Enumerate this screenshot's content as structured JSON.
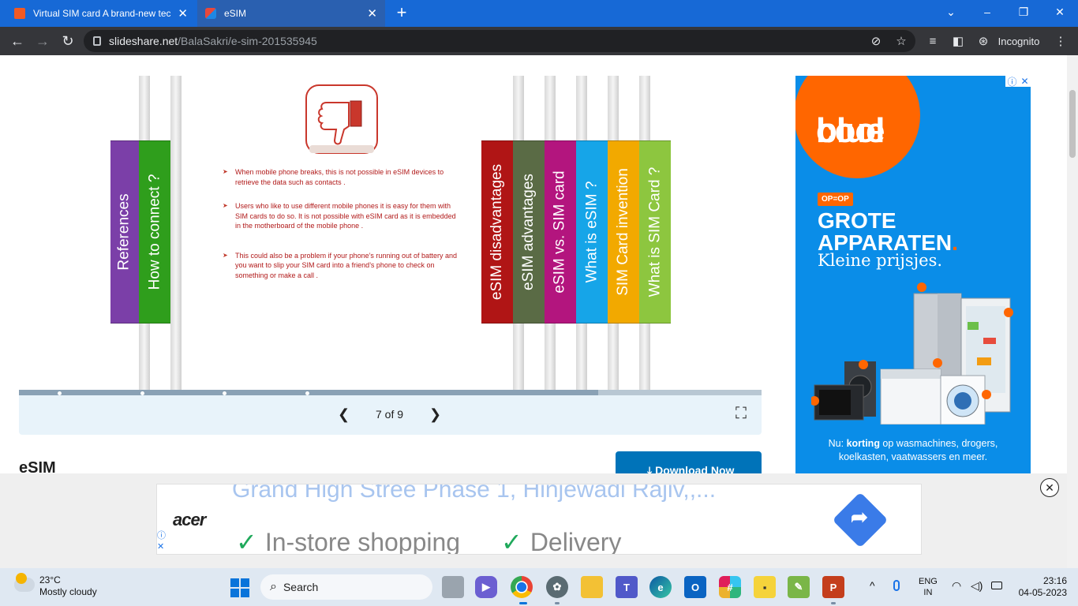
{
  "browser": {
    "tabs": [
      {
        "title": "Virtual SIM card A brand-new tec",
        "close": "✕"
      },
      {
        "title": "eSIM",
        "close": "✕"
      }
    ],
    "new_tab": "+",
    "window_controls": {
      "minimize": "–",
      "restore": "❐",
      "close": "✕"
    },
    "url_domain": "slideshare.net",
    "url_path": "/BalaSakri/e-sim-201535945",
    "profile_label": "Incognito"
  },
  "slide": {
    "left_tabs": [
      {
        "label": "References",
        "color": "#7b3fa8"
      },
      {
        "label": "How to connect ?",
        "color": "#2f9e1c"
      }
    ],
    "right_tabs": [
      {
        "label": "eSIM disadvantages",
        "color": "#b01515"
      },
      {
        "label": "eSIM advantages",
        "color": "#5a6b45"
      },
      {
        "label": "eSIM vs. SIM card",
        "color": "#b3157e"
      },
      {
        "label": "What is eSIM ?",
        "color": "#16a5e8"
      },
      {
        "label": "SIM Card invention",
        "color": "#f2a900"
      },
      {
        "label": "What is SIM Card ?",
        "color": "#8dc63f"
      }
    ],
    "bullets": [
      "When mobile phone breaks, this is not possible in eSIM devices to retrieve the data such as contacts .",
      "Users who like to use different mobile phones it is easy for them with SIM cards to do so. It is not possible with eSIM card as it is embedded in the motherboard of the mobile phone .",
      "This could also be a problem if your phone’s running out of battery and you want to slip your SIM card into a friend’s phone to check on something or make a call ."
    ],
    "progress_percent": 78,
    "pager": {
      "text": "7 of 9",
      "prev": "❮",
      "next": "❯",
      "fullscreen": "⛶"
    }
  },
  "page": {
    "title": "eSIM",
    "download_label": "⤓ Download Now"
  },
  "right_ad": {
    "brand_line1": "cool",
    "brand_line2": "blue",
    "badge": "OP=OP",
    "headline1": "GROTE",
    "headline2": "APPARATEN",
    "headline_dot": ".",
    "subline": "Kleine prijsjes.",
    "footer_prefix": "Nu: ",
    "footer_bold": "korting",
    "footer_rest": " op wasmachines, drogers, koelkasten, vaatwassers en meer.",
    "badges": [
      "ⓘ",
      "✕"
    ],
    "discount_tag": "%"
  },
  "bottom_ad": {
    "address": "Grand High Stree Phase 1, Hinjewadi Rajiv,,...",
    "brand": "acer",
    "features": [
      "In-store shopping",
      "Delivery"
    ],
    "check": "✓",
    "info": "ⓘ",
    "close_small": "✕",
    "close": "✕"
  },
  "taskbar": {
    "temperature": "23°C",
    "weather": "Mostly cloudy",
    "search_label": "Search",
    "language": "ENG",
    "region": "IN",
    "time": "23:16",
    "date": "04-05-2023",
    "tray_icons": [
      "^",
      "🎤",
      "📶",
      "🔊",
      "🔋"
    ]
  }
}
